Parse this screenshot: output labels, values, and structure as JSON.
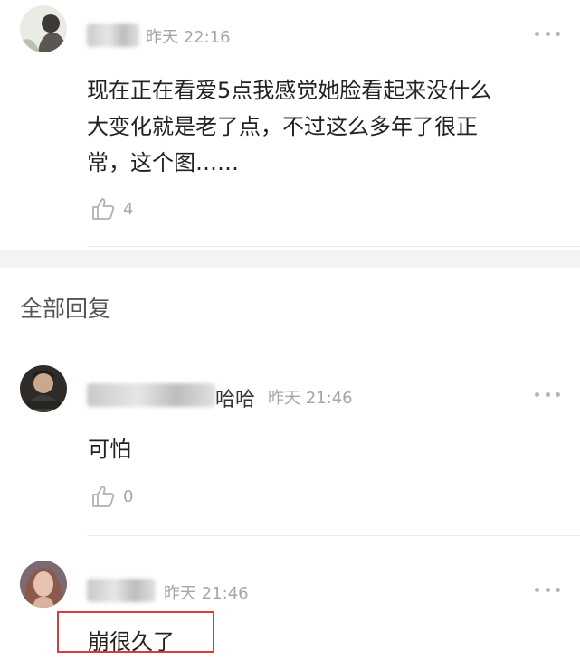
{
  "top_comment": {
    "time": "昨天 22:16",
    "text_lines": [
      "现在正在看爱5点我感觉她脸看起来没什么",
      "大变化就是老了点，不过这么多年了很正",
      "常，这个图……"
    ],
    "like_count": "4"
  },
  "replies_section": {
    "title": "全部回复"
  },
  "replies": [
    {
      "name_suffix": "哈哈",
      "time": "昨天 21:46",
      "text": "可怕",
      "like_count": "0"
    },
    {
      "name_suffix": "",
      "time": "昨天 21:46",
      "text": "崩很久了"
    }
  ],
  "icons": {
    "more": "more-dots-icon",
    "like": "thumbs-up-icon"
  },
  "colors": {
    "highlight": "#d93a3a"
  }
}
